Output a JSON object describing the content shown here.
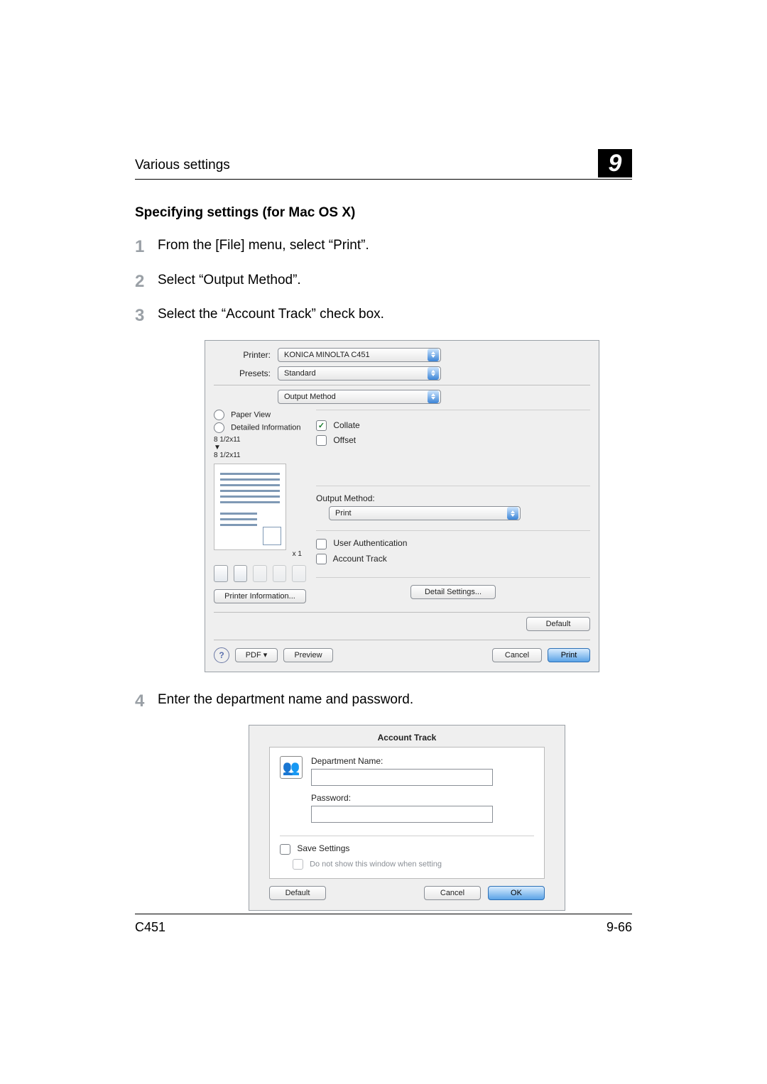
{
  "header": {
    "section": "Various settings",
    "chapter_number": "9"
  },
  "h2": "Specifying settings (for Mac OS X)",
  "steps": [
    "From the [File] menu, select “Print”.",
    "Select “Output Method”.",
    "Select the “Account Track” check box.",
    "Enter the department name and password."
  ],
  "screenshot1": {
    "printer_label": "Printer:",
    "printer_value": "KONICA MINOLTA C451",
    "presets_label": "Presets:",
    "presets_value": "Standard",
    "pane_value": "Output Method",
    "radio_paper_view": "Paper View",
    "radio_detailed": "Detailed Information",
    "dim1": "8 1/2x11",
    "dim2": "8 1/2x11",
    "copies": "x 1",
    "collate": "Collate",
    "offset": "Offset",
    "output_method_label": "Output Method:",
    "output_method_value": "Print",
    "user_auth": "User Authentication",
    "account_track": "Account Track",
    "printer_info_btn": "Printer Information...",
    "detail_settings_btn": "Detail Settings...",
    "default_btn": "Default",
    "pdf_btn": "PDF ▾",
    "preview_btn": "Preview",
    "cancel_btn": "Cancel",
    "print_btn": "Print"
  },
  "screenshot2": {
    "title": "Account Track",
    "dept_label": "Department Name:",
    "pass_label": "Password:",
    "save_settings": "Save Settings",
    "dont_show": "Do not show this window when setting",
    "default_btn": "Default",
    "cancel_btn": "Cancel",
    "ok_btn": "OK"
  },
  "footer": {
    "model": "C451",
    "page": "9-66"
  }
}
